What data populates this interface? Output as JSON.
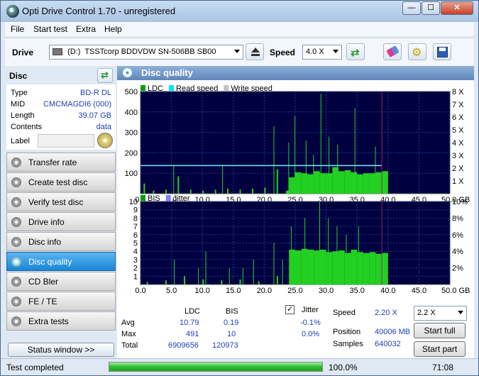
{
  "window": {
    "title": "Opti Drive Control 1.70 - unregistered",
    "controls": [
      "—",
      "☐",
      "✕"
    ]
  },
  "menu": [
    "File",
    "Start test",
    "Extra",
    "Help"
  ],
  "toolbar": {
    "drive_label": "Drive",
    "drive_letter": "(D:)",
    "drive_name": "TSSTcorp BDDVDW SN-506BB SB00",
    "speed_label": "Speed",
    "speed_value": "4.0 X"
  },
  "disc": {
    "header": "Disc",
    "type_label": "Type",
    "type_value": "BD-R DL",
    "mid_label": "MID",
    "mid_value": "CMCMAGDI6 (000)",
    "length_label": "Length",
    "length_value": "39.07 GB",
    "contents_label": "Contents",
    "contents_value": "data",
    "label_label": "Label",
    "label_value": ""
  },
  "nav": [
    {
      "label": "Transfer rate",
      "active": false
    },
    {
      "label": "Create test disc",
      "active": false
    },
    {
      "label": "Verify test disc",
      "active": false
    },
    {
      "label": "Drive info",
      "active": false
    },
    {
      "label": "Disc info",
      "active": false
    },
    {
      "label": "Disc quality",
      "active": true
    },
    {
      "label": "CD Bler",
      "active": false
    },
    {
      "label": "FE / TE",
      "active": false
    },
    {
      "label": "Extra tests",
      "active": false
    }
  ],
  "status_window_button": "Status window >>",
  "panel_title": "Disc quality",
  "chart_data": [
    {
      "type": "bar",
      "legend": [
        "LDC",
        "Read speed",
        "Write speed"
      ],
      "legend_colors": [
        "#00a000",
        "#00e5ff",
        "#c0c0c0"
      ],
      "x_ticks": [
        "0.0",
        "5.0",
        "10.0",
        "15.0",
        "20.0",
        "25.0",
        "30.0",
        "35.0",
        "40.0",
        "45.0",
        "50.0 GB"
      ],
      "xlim": [
        0,
        50
      ],
      "y_ticks": [
        "100",
        "200",
        "300",
        "400",
        "500"
      ],
      "ylim": [
        0,
        500
      ],
      "y2_ticks": [
        "1 X",
        "2 X",
        "3 X",
        "4 X",
        "5 X",
        "6 X",
        "7 X",
        "8 X"
      ],
      "y2lim": [
        0,
        8
      ],
      "series": [
        {
          "name": "LDC",
          "x": [
            0.5,
            2,
            4,
            6,
            8,
            10,
            12,
            14,
            16,
            18,
            20,
            22,
            23.5,
            24,
            25,
            26,
            27,
            28,
            29,
            30,
            31,
            32,
            33,
            34,
            35,
            36,
            37,
            38,
            39
          ],
          "values": [
            50,
            15,
            20,
            85,
            20,
            15,
            20,
            25,
            20,
            25,
            30,
            120,
            15,
            80,
            105,
            100,
            95,
            110,
            100,
            100,
            130,
            110,
            115,
            105,
            95,
            100,
            100,
            105,
            110
          ]
        },
        {
          "name": "LDC spikes",
          "x": [
            5.3,
            13.2,
            21.5,
            23.9,
            24.9,
            26.7,
            27.9,
            29.1,
            30.4,
            31.8,
            34.6,
            37.9
          ],
          "values": [
            140,
            140,
            330,
            250,
            380,
            260,
            190,
            490,
            280,
            240,
            420,
            230
          ]
        },
        {
          "name": "Read speed",
          "x": [
            0,
            23.5,
            24,
            39
          ],
          "values": [
            2.2,
            2.2,
            2.2,
            2.2
          ]
        }
      ]
    },
    {
      "type": "bar",
      "legend": [
        "BIS",
        "Jitter"
      ],
      "legend_colors": [
        "#00a000",
        "#8080ff"
      ],
      "x_ticks": [
        "0.0",
        "5.0",
        "10.0",
        "15.0",
        "20.0",
        "25.0",
        "30.0",
        "35.0",
        "40.0",
        "45.0",
        "50.0 GB"
      ],
      "xlim": [
        0,
        50
      ],
      "y_ticks": [
        "1",
        "2",
        "3",
        "4",
        "5",
        "6",
        "7",
        "8",
        "9",
        "10"
      ],
      "ylim": [
        0,
        10
      ],
      "y2_ticks": [
        "2%",
        "4%",
        "6%",
        "8%",
        "10%"
      ],
      "y2lim": [
        0,
        10
      ],
      "series": [
        {
          "name": "BIS",
          "x": [
            1,
            4,
            7,
            10,
            13,
            16,
            19,
            22,
            24,
            25,
            26,
            27,
            28,
            29,
            30,
            31,
            32,
            33,
            34,
            35,
            36,
            37,
            38,
            39
          ],
          "values": [
            0.3,
            0.5,
            1,
            0.6,
            0.5,
            0.6,
            0.4,
            1,
            4.2,
            4.1,
            4.3,
            4.2,
            4.1,
            4.2,
            3.9,
            4.0,
            4.1,
            3.8,
            4.2,
            3.9,
            3.8,
            3.9,
            3.7,
            3.8
          ]
        },
        {
          "name": "BIS spikes",
          "x": [
            5.4,
            9.3,
            10.5,
            14.3,
            16.5,
            18.2,
            21.5,
            22.9,
            24.3,
            26.5,
            28.9,
            30.3,
            31.7,
            33.2,
            35.2
          ],
          "values": [
            3,
            2,
            4,
            2,
            2,
            3,
            5,
            3,
            7,
            8,
            10,
            8,
            7,
            6,
            7
          ]
        }
      ]
    }
  ],
  "stats": {
    "col_ldc": "LDC",
    "col_bis": "BIS",
    "avg_label": "Avg",
    "avg_ldc": "10.79",
    "avg_bis": "0.19",
    "max_label": "Max",
    "max_ldc": "491",
    "max_bis": "10",
    "total_label": "Total",
    "total_ldc": "6909656",
    "total_bis": "120973",
    "jitter_label": "Jitter",
    "jitter_checked": true,
    "jitter_avg": "-0.1%",
    "jitter_max": "0.0%",
    "speed_label": "Speed",
    "speed_value": "2.20 X",
    "position_label": "Position",
    "position_value": "40006 MB",
    "samples_label": "Samples",
    "samples_value": "640032",
    "speed_select": "2.2 X",
    "start_full": "Start full",
    "start_part": "Start part"
  },
  "statusbar": {
    "text": "Test completed",
    "progress": 100,
    "progress_text": "100.0%",
    "time": "71:08"
  }
}
